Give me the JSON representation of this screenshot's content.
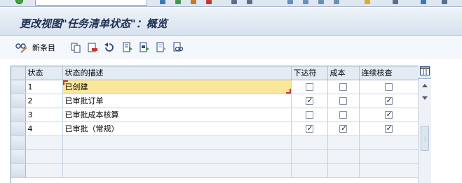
{
  "window": {
    "title": "更改视图\"任务清单状态\"：概览"
  },
  "toolbar": {
    "new_entries_label": "新条目",
    "icons": [
      "glasses-edit-icon",
      "copy-icon",
      "delete-icon",
      "undo-icon",
      "select-all-icon",
      "select-block-icon",
      "deselect-all-icon",
      "find-icon"
    ]
  },
  "table": {
    "columns": {
      "status": "状态",
      "description": "状态的描述",
      "release": "下达符",
      "cost": "成本",
      "continuous_check": "连续核查"
    },
    "rows": [
      {
        "status": "1",
        "description": "已创建",
        "release": false,
        "cost": false,
        "continuous_check": false
      },
      {
        "status": "2",
        "description": "已审批订单",
        "release": true,
        "cost": false,
        "continuous_check": true
      },
      {
        "status": "3",
        "description": "已审批成本核算",
        "release": false,
        "cost": false,
        "continuous_check": true
      },
      {
        "status": "4",
        "description": "已审批（常规）",
        "release": true,
        "cost": true,
        "continuous_check": true
      }
    ],
    "empty_rows": 3
  },
  "colors": {
    "title_text": "#1e2f52",
    "header_bg": "#e3ebf5",
    "active_cell": "#fbe79a"
  }
}
